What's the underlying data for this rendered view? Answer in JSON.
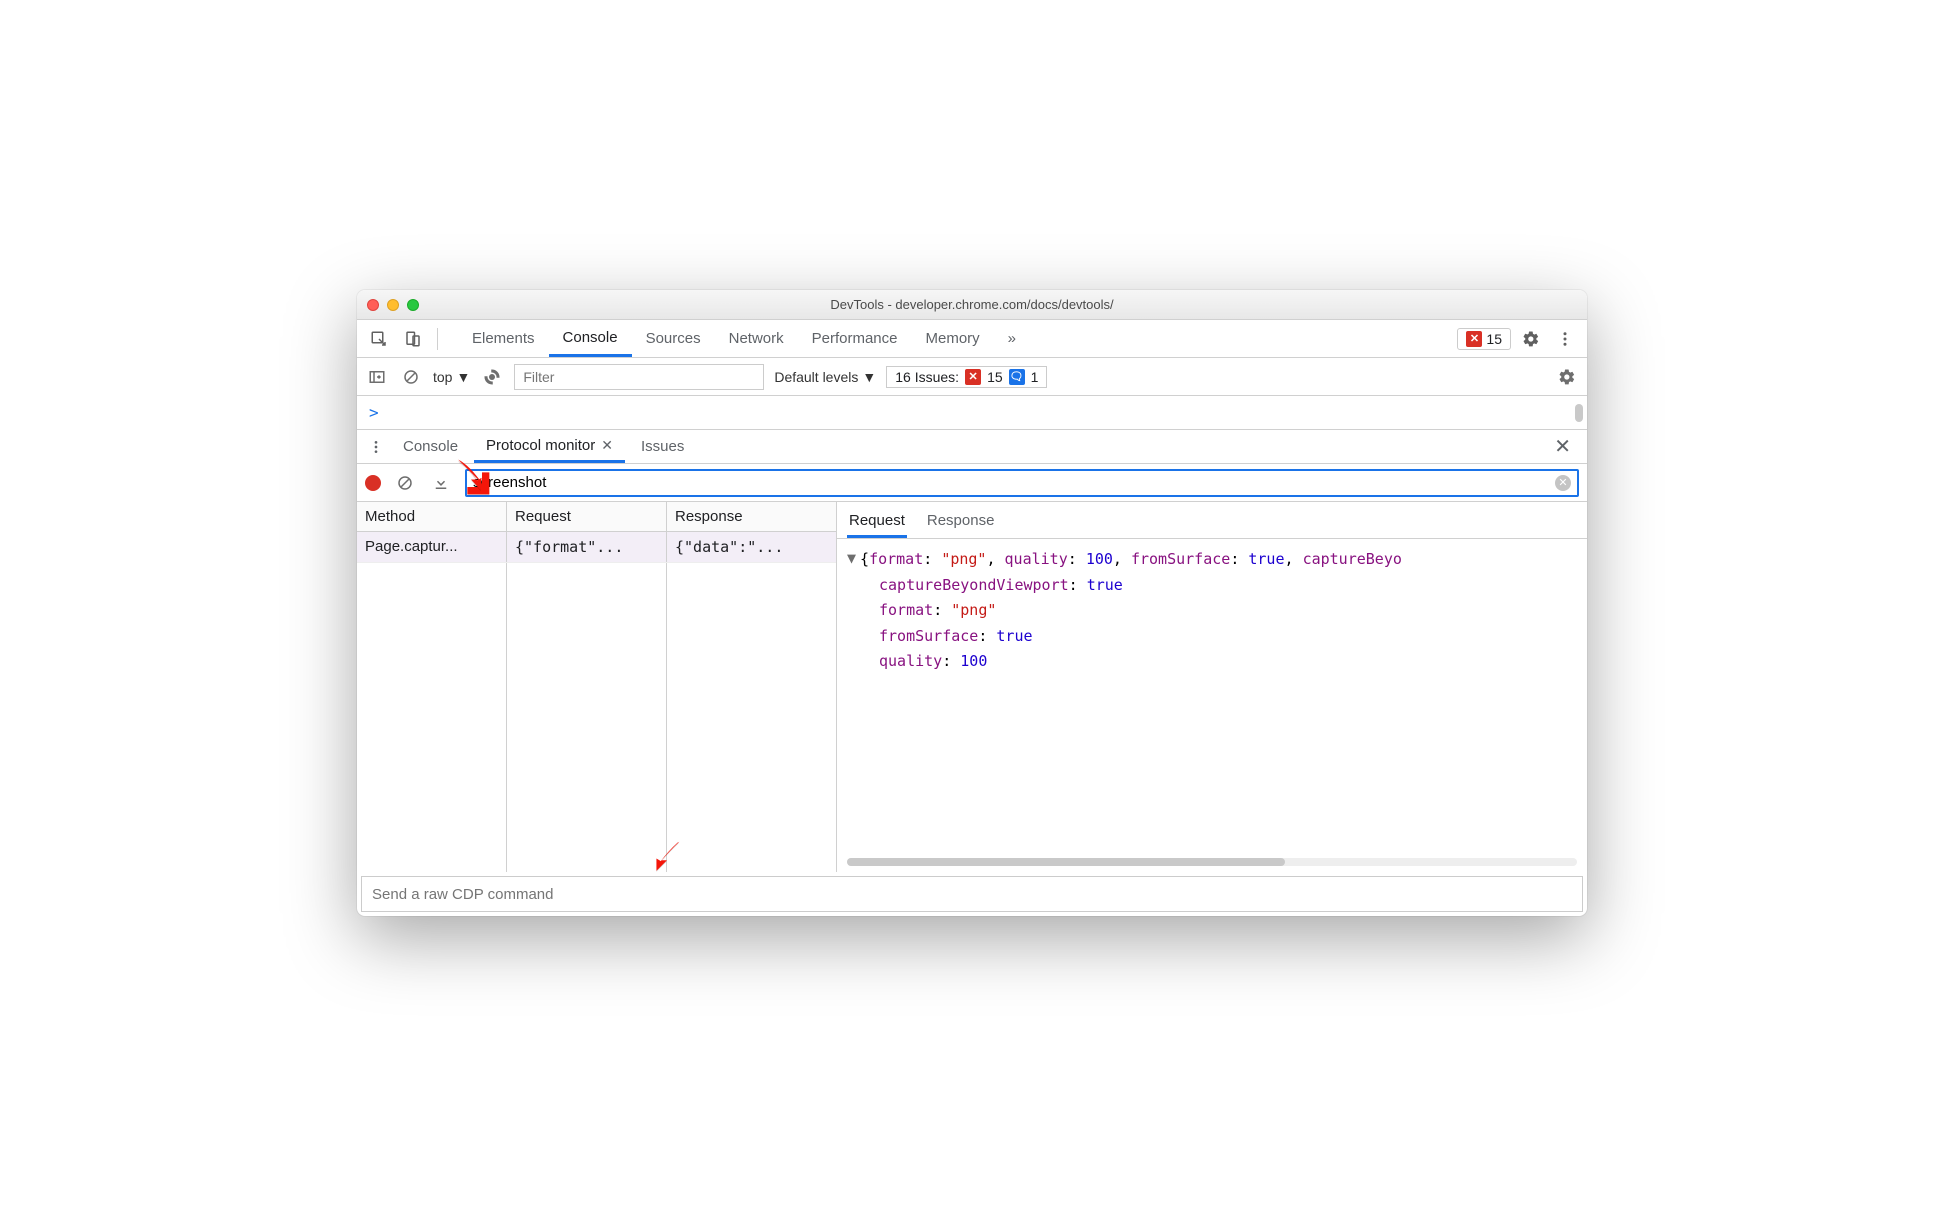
{
  "window": {
    "title": "DevTools - developer.chrome.com/docs/devtools/"
  },
  "mainTabs": {
    "items": [
      "Elements",
      "Console",
      "Sources",
      "Network",
      "Performance",
      "Memory"
    ],
    "activeIndex": 1,
    "overflow": "»"
  },
  "errorBadge": {
    "count": "15"
  },
  "subbar": {
    "context": "top",
    "filterPlaceholder": "Filter",
    "levels": "Default levels",
    "issuesLabel": "16 Issues:",
    "issuesError": "15",
    "issuesInfo": "1"
  },
  "console": {
    "prompt": ">"
  },
  "drawer": {
    "tabs": [
      {
        "label": "Console",
        "closable": false
      },
      {
        "label": "Protocol monitor",
        "closable": true
      },
      {
        "label": "Issues",
        "closable": false
      }
    ],
    "activeIndex": 1
  },
  "protocolMonitor": {
    "searchValue": "screenshot",
    "columns": [
      "Method",
      "Request",
      "Response"
    ],
    "rows": [
      {
        "method": "Page.captur...",
        "request": "{\"format\"...",
        "response": "{\"data\":\"..."
      }
    ],
    "detailTabs": [
      "Request",
      "Response"
    ],
    "detailActive": 0,
    "json": {
      "summaryPrefix": "{",
      "summaryPairs": "format: \"png\", quality: 100, fromSurface: true, captureBeyo",
      "lines": [
        {
          "key": "captureBeyondViewport",
          "type": "bool",
          "val": "true"
        },
        {
          "key": "format",
          "type": "str",
          "val": "\"png\""
        },
        {
          "key": "fromSurface",
          "type": "bool",
          "val": "true"
        },
        {
          "key": "quality",
          "type": "num",
          "val": "100"
        }
      ]
    },
    "cdpPlaceholder": "Send a raw CDP command"
  }
}
